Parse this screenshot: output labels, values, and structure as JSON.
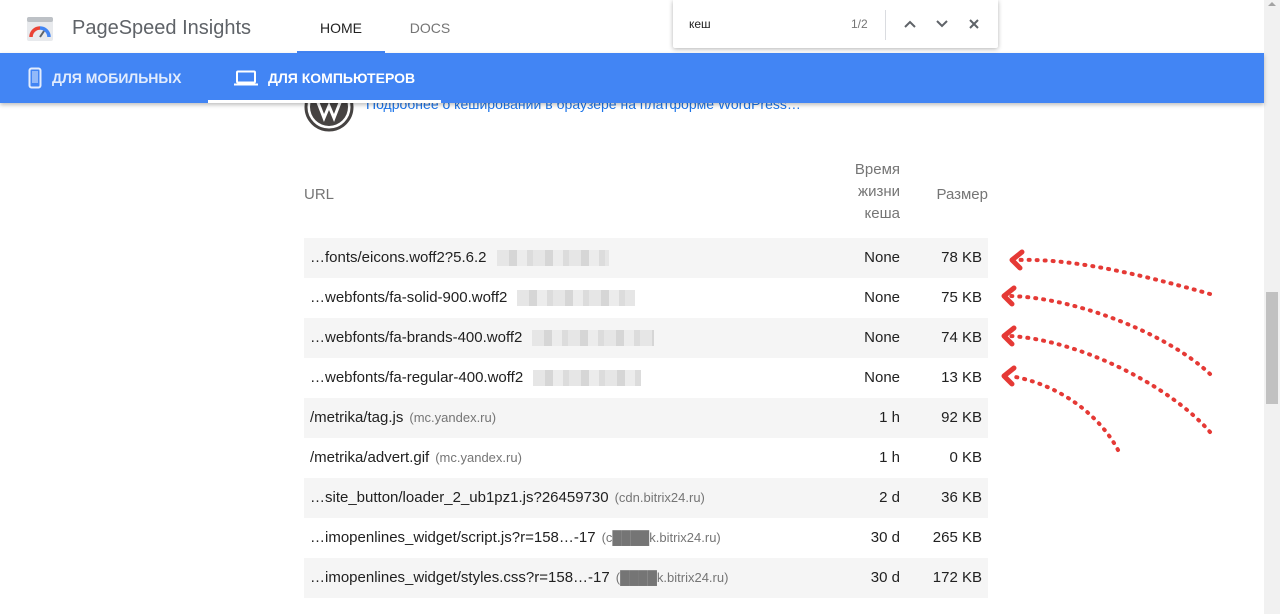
{
  "app": {
    "title": "PageSpeed Insights"
  },
  "nav": {
    "tabs": [
      {
        "label": "HOME",
        "active": true
      },
      {
        "label": "DOCS",
        "active": false
      }
    ]
  },
  "devices": {
    "mobile_label": "ДЛЯ МОБИЛЬНЫХ",
    "desktop_label": "ДЛЯ КОМПЬЮТЕРОВ",
    "active": "desktop"
  },
  "find": {
    "query": "кеш",
    "count": "1/2"
  },
  "content": {
    "wordpress_link": "Подробнее о кешировании в браузере на платформе WordPress…",
    "headers": {
      "url": "URL",
      "ttl_line1": "Время",
      "ttl_line2": "жизни",
      "ttl_line3": "кеша",
      "size": "Размер"
    },
    "rows": [
      {
        "url": "…fonts/eicons.woff2?5.6.2",
        "host": "",
        "ttl": "None",
        "size": "78 KB",
        "shaded": true
      },
      {
        "url": "…webfonts/fa-solid-900.woff2",
        "host": "",
        "ttl": "None",
        "size": "75 KB",
        "shaded": false
      },
      {
        "url": "…webfonts/fa-brands-400.woff2",
        "host": "",
        "ttl": "None",
        "size": "74 KB",
        "shaded": true
      },
      {
        "url": "…webfonts/fa-regular-400.woff2",
        "host": "",
        "ttl": "None",
        "size": "13 KB",
        "shaded": false
      },
      {
        "url": "/metrika/tag.js",
        "host": "(mc.yandex.ru)",
        "ttl": "1 h",
        "size": "92 KB",
        "shaded": true
      },
      {
        "url": "/metrika/advert.gif",
        "host": "(mc.yandex.ru)",
        "ttl": "1 h",
        "size": "0 KB",
        "shaded": false
      },
      {
        "url": "…site_button/loader_2_ub1pz1.js?26459730",
        "host": "(cdn.bitrix24.ru)",
        "ttl": "2 d",
        "size": "36 KB",
        "shaded": true
      },
      {
        "url": "…imopenlines_widget/script.js?r=158…-17",
        "host": "(c████k.bitrix24.ru)",
        "ttl": "30 d",
        "size": "265 KB",
        "shaded": false
      },
      {
        "url": "…imopenlines_widget/styles.css?r=158…-17",
        "host": "(████k.bitrix24.ru)",
        "ttl": "30 d",
        "size": "172 KB",
        "shaded": true
      }
    ]
  },
  "colors": {
    "accent": "#4285f4",
    "annotation_arrow": "#e53935",
    "row_shade": "#f5f5f5"
  }
}
